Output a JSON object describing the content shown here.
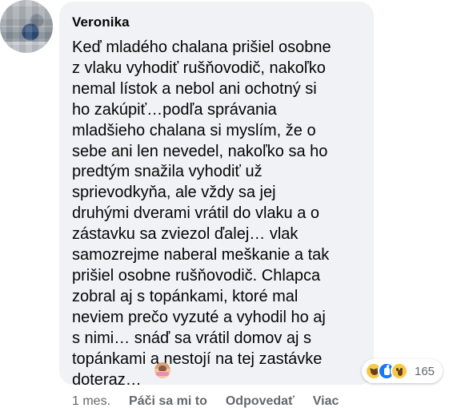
{
  "author": {
    "name": "Veronika"
  },
  "comment": {
    "text": "Keď mladého chalana prišiel osobne\nz vlaku vyhodiť rušňovodič, nakoľko\nnemal lístok a nebol ani ochotný si\nho zakúpiť…podľa správania\nmladšieho chalana si myslím, že o\nsebe ani len nevedel, nakoľko sa ho\npredtým snažila vyhodiť už\nsprievodkyňa, ale vždy sa jej\ndruhými dverami vrátil do vlaku a o\nzástavku sa zviezol ďalej… vlak\nsamozrejme naberal meškanie a tak\nprišiel osobne rušňovodič. Chlapca\nzobral aj s topánkami, ktoré mal\nneviem prečo vyzuté a vyhodil ho aj\ns nimi… snáď sa vrátil domov aj s\ntopánkami a nestojí na tej zastávke\ndoteraz…",
    "emoji": "woman-shrugging-emoji"
  },
  "reactions": {
    "icons": [
      "haha-icon",
      "like-icon",
      "wow-icon"
    ],
    "count": "165"
  },
  "actions": {
    "time": "1 mes.",
    "like": "Páči sa mi to",
    "reply": "Odpovedať",
    "more": "Viac"
  }
}
